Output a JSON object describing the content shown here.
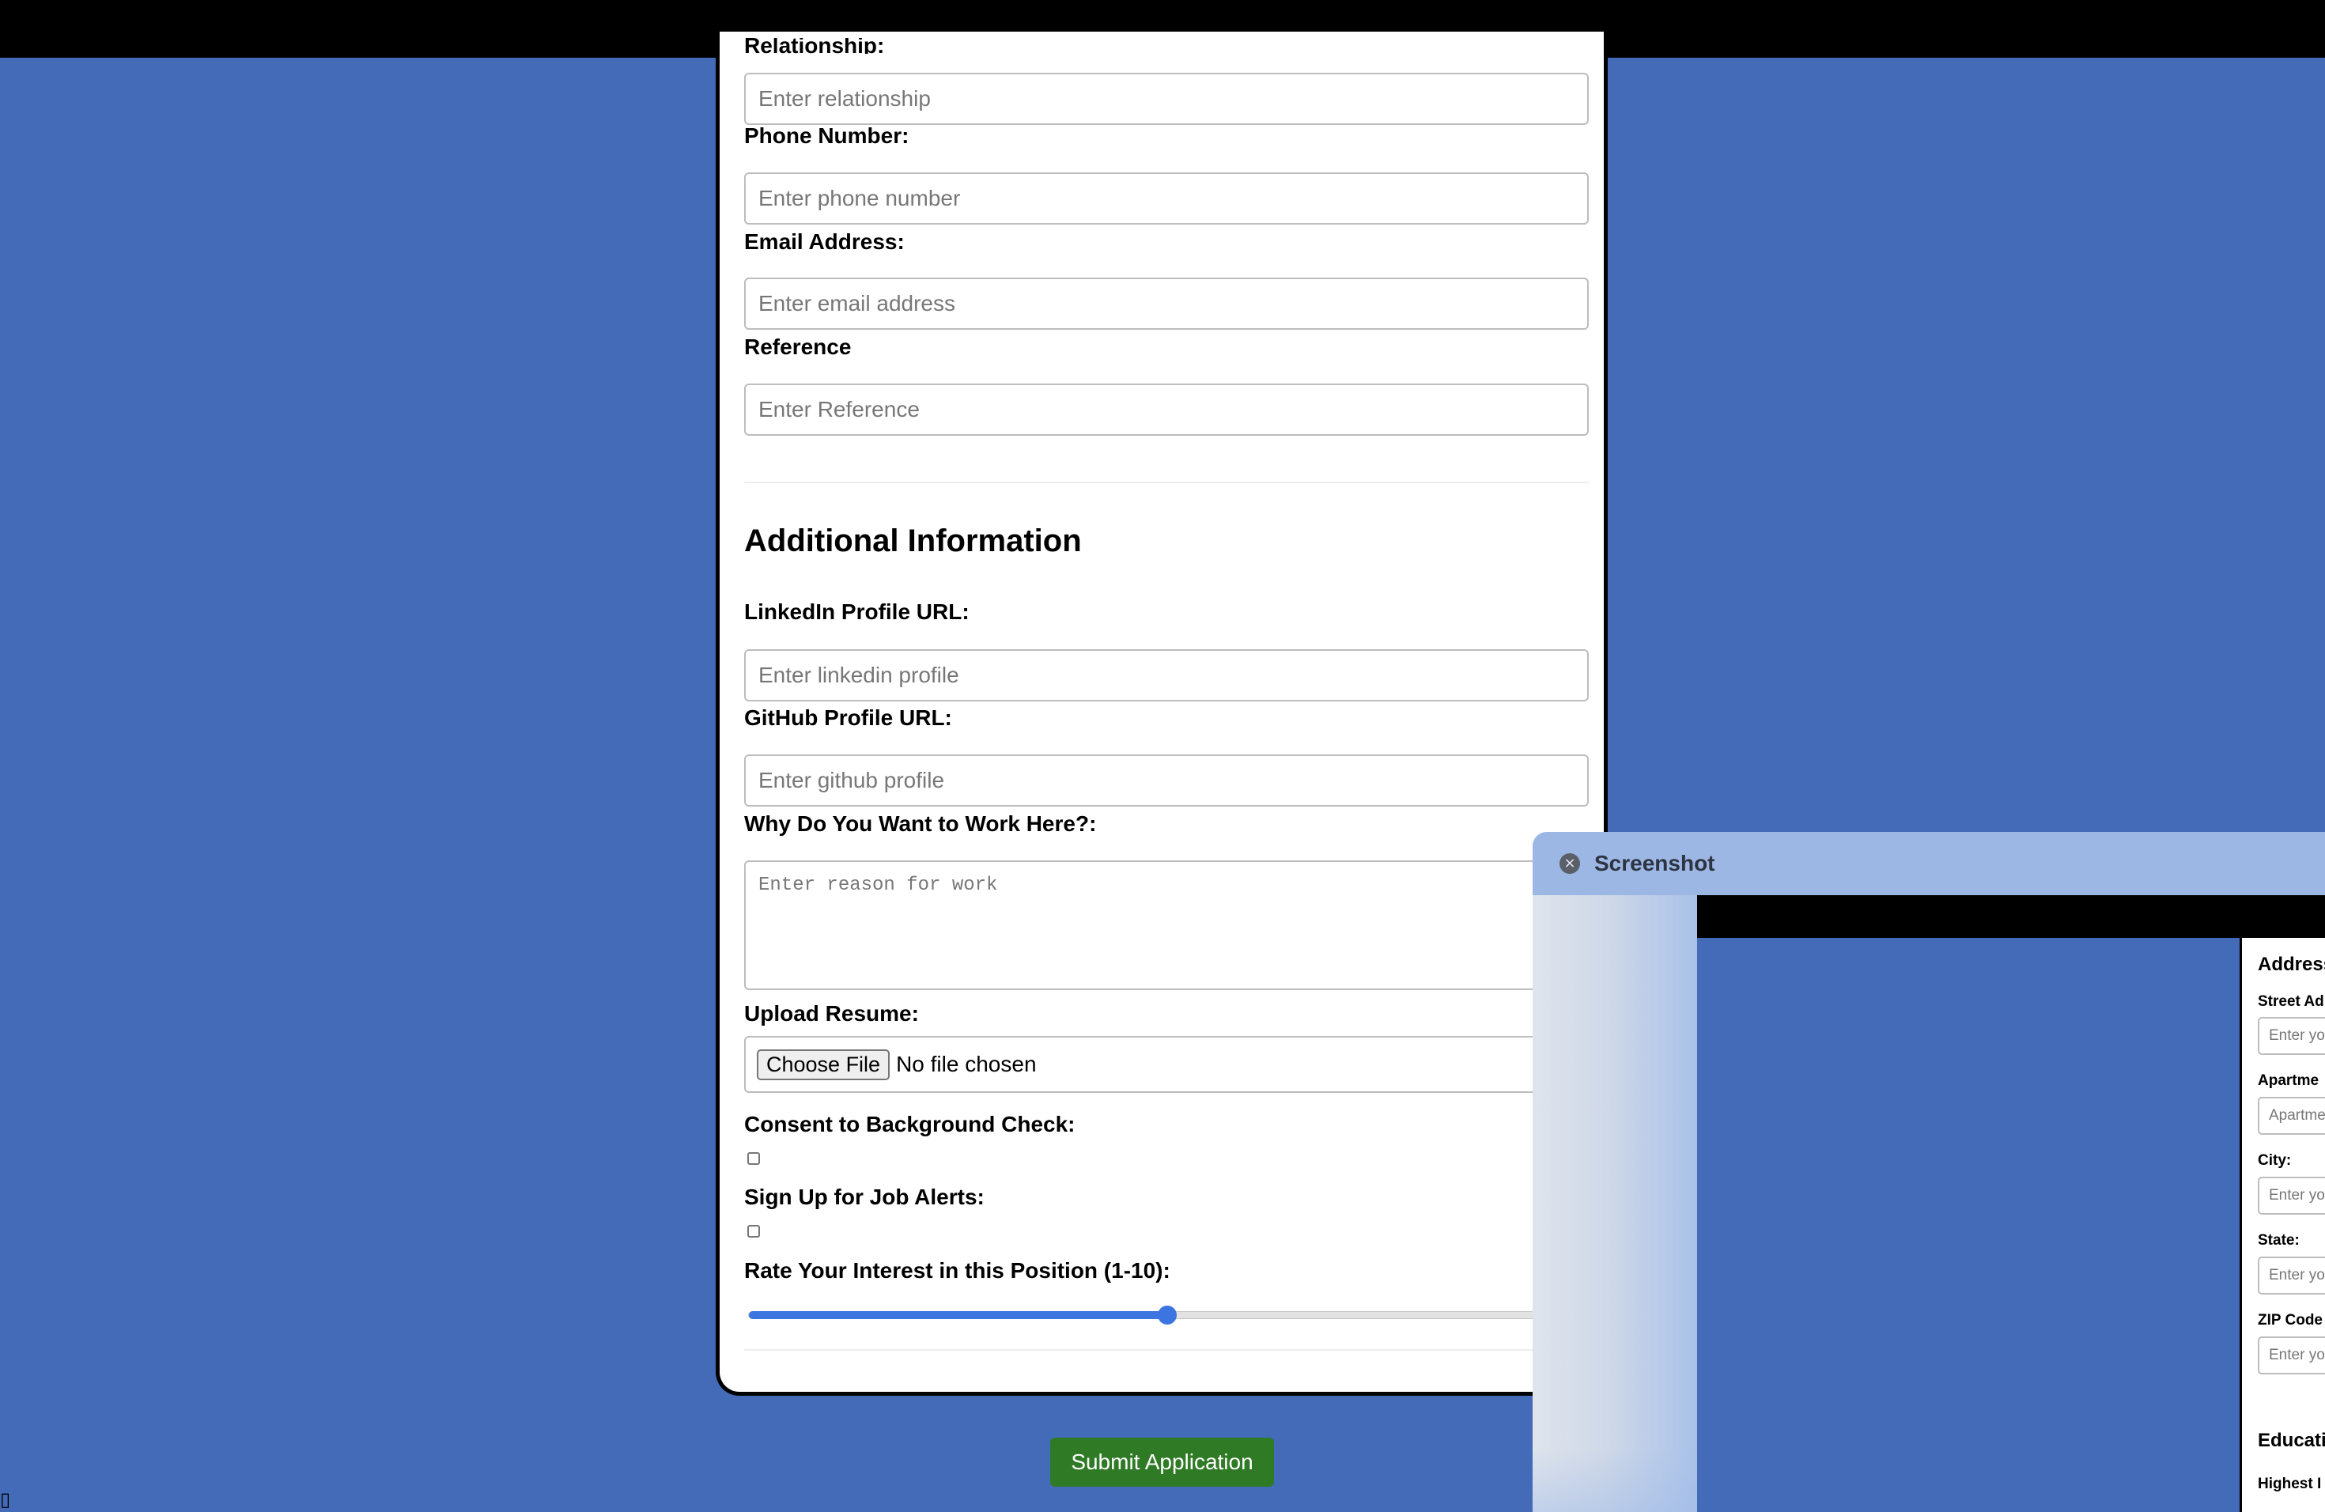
{
  "form": {
    "cut_label": "Relationship:",
    "fields_top": [
      {
        "placeholder": "Enter relationship"
      },
      {
        "label": "Phone Number:",
        "placeholder": "Enter phone number"
      },
      {
        "label": "Email Address:",
        "placeholder": "Enter email address"
      },
      {
        "label": "Reference",
        "placeholder": "Enter Reference"
      }
    ],
    "additional_section_title": "Additional Information",
    "linkedin": {
      "label": "LinkedIn Profile URL:",
      "placeholder": "Enter linkedin profile"
    },
    "github": {
      "label": "GitHub Profile URL:",
      "placeholder": "Enter github profile"
    },
    "why_work": {
      "label": "Why Do You Want to Work Here?:",
      "placeholder": "Enter reason for work"
    },
    "resume": {
      "label": "Upload Resume:",
      "button": "Choose File",
      "status": "No file chosen"
    },
    "background_check": {
      "label": "Consent to Background Check:",
      "checked": false
    },
    "job_alerts": {
      "label": "Sign Up for Job Alerts:",
      "checked": false
    },
    "interest": {
      "label": "Rate Your Interest in this Position (1-10):",
      "value": 5.5,
      "min": 1,
      "max": 10
    },
    "submit_label": "Submit Application"
  },
  "corner_glyph": "▯",
  "screenshot_window": {
    "title": "Screenshot",
    "close_icon": "×",
    "mini_form": {
      "section_address": "Address",
      "street_label": "Street Ad",
      "street_placeholder": "Enter yo",
      "apt_label": "Apartme",
      "apt_placeholder": "Apartme",
      "city_label": "City:",
      "city_placeholder": "Enter yo",
      "state_label": "State:",
      "state_placeholder": "Enter yo",
      "zip_label": "ZIP Code",
      "zip_placeholder": "Enter yo",
      "section_education": "Educati",
      "highest_label": "Highest I"
    }
  },
  "colors": {
    "page_bg": "#446bb8",
    "submit_bg": "#2f7a25",
    "slider_accent": "#3c75e0",
    "overlay_bg": "#a3bde8"
  }
}
